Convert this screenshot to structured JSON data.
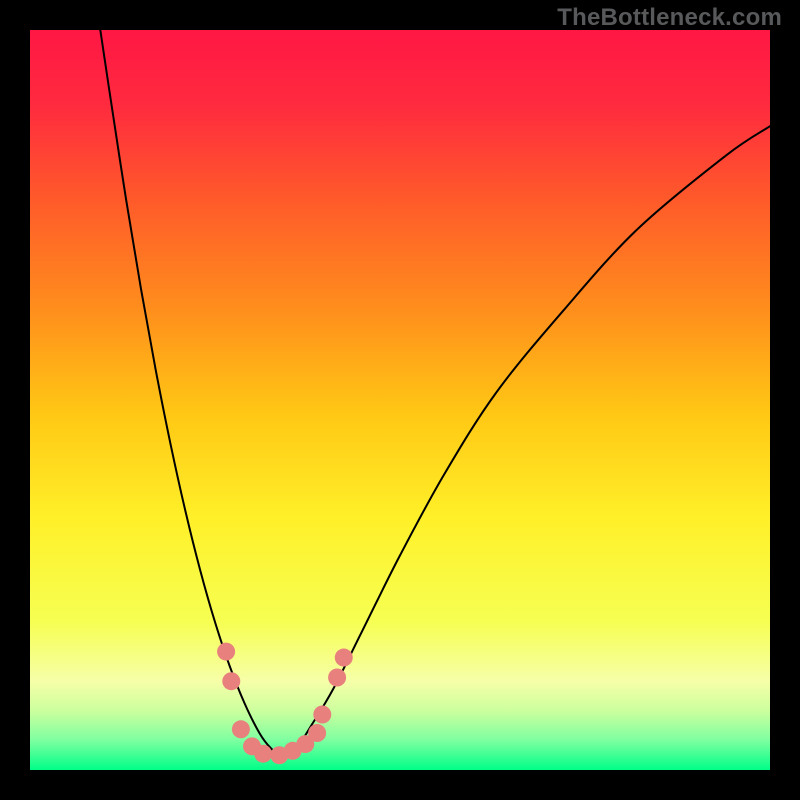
{
  "watermark": "TheBottleneck.com",
  "chart_data": {
    "type": "line",
    "title": "",
    "xlabel": "",
    "ylabel": "",
    "xlim": [
      0,
      100
    ],
    "ylim": [
      0,
      100
    ],
    "grid": false,
    "legend": false,
    "background": {
      "kind": "vertical-gradient",
      "stops": [
        {
          "t": 0.0,
          "color": "#ff1744"
        },
        {
          "t": 0.1,
          "color": "#ff2a3f"
        },
        {
          "t": 0.23,
          "color": "#ff5a2a"
        },
        {
          "t": 0.38,
          "color": "#ff8f1c"
        },
        {
          "t": 0.52,
          "color": "#ffc814"
        },
        {
          "t": 0.66,
          "color": "#fff029"
        },
        {
          "t": 0.8,
          "color": "#f6ff52"
        },
        {
          "t": 0.88,
          "color": "#f6ffa8"
        },
        {
          "t": 0.92,
          "color": "#ccff9e"
        },
        {
          "t": 0.96,
          "color": "#7dffa0"
        },
        {
          "t": 1.0,
          "color": "#00ff88"
        }
      ]
    },
    "series": [
      {
        "name": "curve",
        "color": "#000000",
        "width": 2,
        "x": [
          9.5,
          11,
          13,
          15,
          17,
          19,
          21,
          23,
          25,
          27,
          29,
          31,
          32.5,
          34,
          36,
          38,
          41,
          45,
          50,
          56,
          63,
          72,
          82,
          94,
          100
        ],
        "y": [
          100,
          90,
          77,
          65,
          54,
          44,
          35,
          27,
          20,
          14,
          9,
          5,
          3,
          2,
          3,
          6,
          11,
          19,
          29,
          40,
          51,
          62,
          73,
          83,
          87
        ]
      }
    ],
    "markers": [
      {
        "name": "dots",
        "color": "#e8817e",
        "radius": 9,
        "points": [
          {
            "x": 26.5,
            "y": 16
          },
          {
            "x": 27.2,
            "y": 12
          },
          {
            "x": 28.5,
            "y": 5.5
          },
          {
            "x": 30.0,
            "y": 3.2
          },
          {
            "x": 31.5,
            "y": 2.2
          },
          {
            "x": 33.7,
            "y": 2.0
          },
          {
            "x": 35.5,
            "y": 2.6
          },
          {
            "x": 37.2,
            "y": 3.5
          },
          {
            "x": 38.8,
            "y": 5.0
          },
          {
            "x": 39.5,
            "y": 7.5
          },
          {
            "x": 41.5,
            "y": 12.5
          },
          {
            "x": 42.4,
            "y": 15.2
          }
        ]
      }
    ]
  }
}
